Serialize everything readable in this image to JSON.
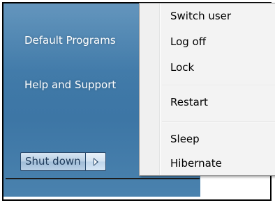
{
  "start_panel": {
    "items": [
      {
        "label": "Default Programs"
      },
      {
        "label": "Help and Support"
      }
    ],
    "shutdown_label": "Shut down"
  },
  "power_menu": {
    "items": [
      {
        "label": "Switch user"
      },
      {
        "label": "Log off"
      },
      {
        "label": "Lock"
      },
      {
        "label": "Restart"
      },
      {
        "label": "Sleep"
      },
      {
        "label": "Hibernate"
      }
    ]
  }
}
